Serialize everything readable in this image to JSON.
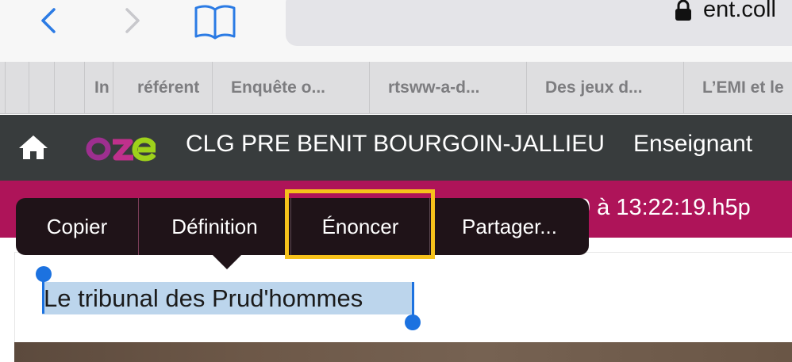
{
  "browser": {
    "url": "ent.coll",
    "tabs": [
      {
        "label": "In"
      },
      {
        "label": "référent"
      },
      {
        "label": "Enquête o..."
      },
      {
        "label": "rtsww-a-d..."
      },
      {
        "label": "Des jeux d..."
      },
      {
        "label": "L’EMI et le"
      }
    ]
  },
  "header": {
    "school_name": "CLG PRE BENIT BOURGOIN-JALLIEU",
    "role": "Enseignant"
  },
  "strip": {
    "text": "9 à 13:22:19.h5p"
  },
  "content": {
    "selected_text": "Le tribunal des Prud'hommes"
  },
  "edit_menu": {
    "items": [
      {
        "label": "Copier"
      },
      {
        "label": "Définition"
      },
      {
        "label": "Énoncer"
      },
      {
        "label": "Partager..."
      }
    ]
  },
  "colors": {
    "header_bg": "#383c3d",
    "strip_bg": "#ae1459",
    "selection": "#bcd5ec",
    "handle": "#1c72e0",
    "highlight": "#f6c21b",
    "ios_blue": "#2b7be4"
  }
}
